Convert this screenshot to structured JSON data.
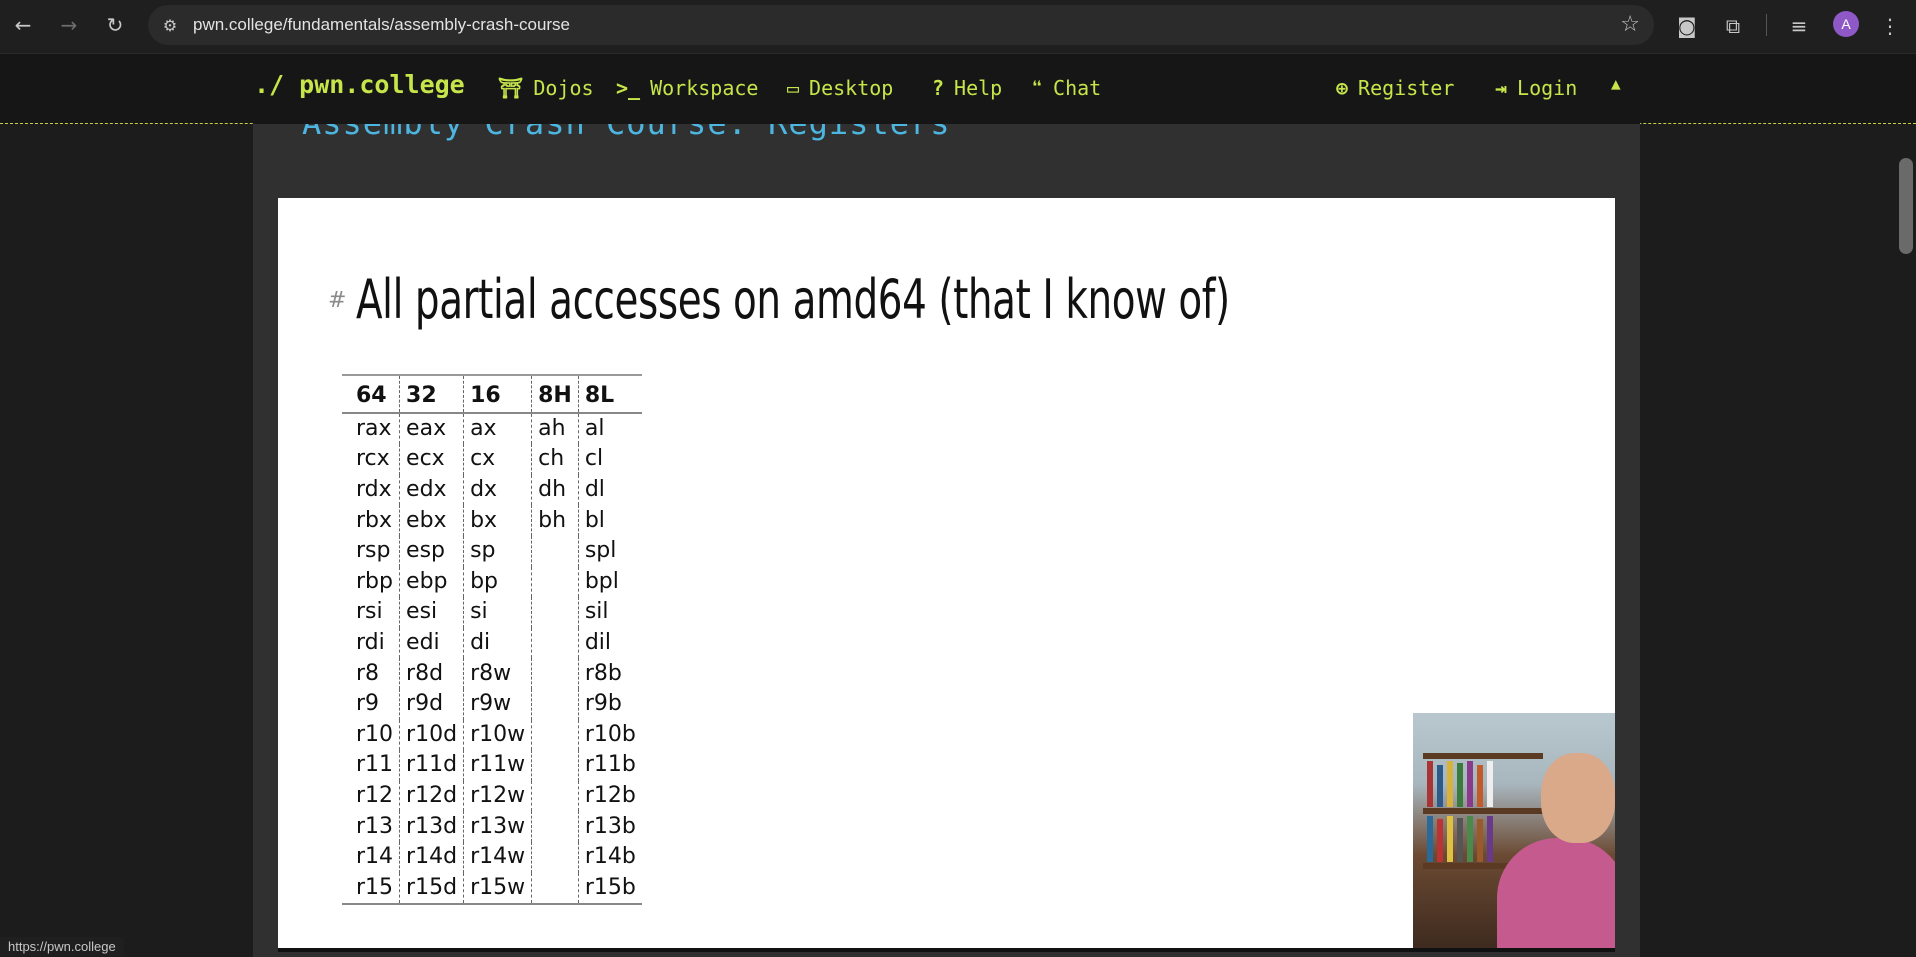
{
  "browser": {
    "url": "pwn.college/fundamentals/assembly-crash-course",
    "status_url": "https://pwn.college",
    "profile_initial": "A"
  },
  "site": {
    "brand": "./ pwn.college",
    "nav": [
      {
        "label": "Dojos",
        "icon": "torii-icon"
      },
      {
        "label": "Workspace",
        "icon": "terminal-icon"
      },
      {
        "label": "Desktop",
        "icon": "monitor-icon"
      },
      {
        "label": "Help",
        "icon": "question-icon"
      },
      {
        "label": "Chat",
        "icon": "chat-icon"
      }
    ],
    "auth": [
      {
        "label": "Register",
        "icon": "user-plus-icon"
      },
      {
        "label": "Login",
        "icon": "sign-in-icon"
      }
    ],
    "accent": "#c5e54a"
  },
  "page": {
    "section_title": "Assembly Crash Course: Registers"
  },
  "slide": {
    "hash": "#",
    "heading": "All partial accesses on amd64 (that I know of)",
    "columns": [
      "64",
      "32",
      "16",
      "8H",
      "8L"
    ],
    "rows": [
      [
        "rax",
        "eax",
        "ax",
        "ah",
        "al"
      ],
      [
        "rcx",
        "ecx",
        "cx",
        "ch",
        "cl"
      ],
      [
        "rdx",
        "edx",
        "dx",
        "dh",
        "dl"
      ],
      [
        "rbx",
        "ebx",
        "bx",
        "bh",
        "bl"
      ],
      [
        "rsp",
        "esp",
        "sp",
        "",
        "spl"
      ],
      [
        "rbp",
        "ebp",
        "bp",
        "",
        "bpl"
      ],
      [
        "rsi",
        "esi",
        "si",
        "",
        "sil"
      ],
      [
        "rdi",
        "edi",
        "di",
        "",
        "dil"
      ],
      [
        "r8",
        "r8d",
        "r8w",
        "",
        "r8b"
      ],
      [
        "r9",
        "r9d",
        "r9w",
        "",
        "r9b"
      ],
      [
        "r10",
        "r10d",
        "r10w",
        "",
        "r10b"
      ],
      [
        "r11",
        "r11d",
        "r11w",
        "",
        "r11b"
      ],
      [
        "r12",
        "r12d",
        "r12w",
        "",
        "r12b"
      ],
      [
        "r13",
        "r13d",
        "r13w",
        "",
        "r13b"
      ],
      [
        "r14",
        "r14d",
        "r14w",
        "",
        "r14b"
      ],
      [
        "r15",
        "r15d",
        "r15w",
        "",
        "r15b"
      ]
    ]
  }
}
